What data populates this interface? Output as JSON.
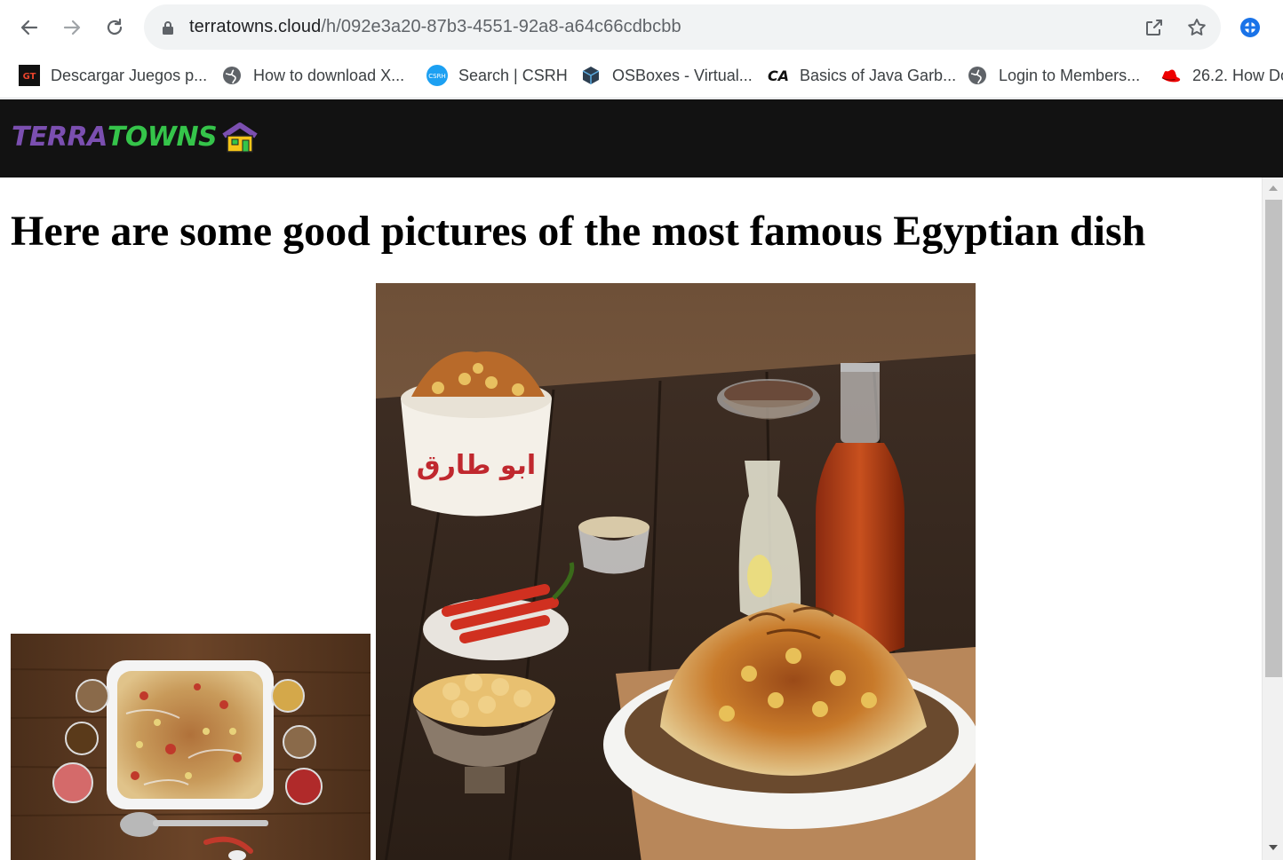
{
  "browser": {
    "url_host": "terratowns.cloud",
    "url_path": "/h/092e3a20-87b3-4551-92a8-a64c66cdbcbb",
    "bookmarks": [
      {
        "label": "Descargar Juegos p...",
        "icon": "gt-icon"
      },
      {
        "label": "How to download X...",
        "icon": "globe-icon"
      },
      {
        "label": "Search | CSRH",
        "icon": "csrh-icon"
      },
      {
        "label": "OSBoxes - Virtual...",
        "icon": "cube-icon"
      },
      {
        "label": "Basics of Java Garb...",
        "icon": "ca-icon"
      },
      {
        "label": "Login to Members...",
        "icon": "globe-icon"
      },
      {
        "label": "26.2. How Do",
        "icon": "redhat-icon"
      }
    ]
  },
  "site": {
    "logo_terra": "TERRA",
    "logo_towns": "TOWNS"
  },
  "page": {
    "title": "Here are some good pictures of the most famous Egyptian dish",
    "images": [
      {
        "description": "koshari platter"
      },
      {
        "description": "koshari bowl",
        "bowl_text": "ابو طارق"
      }
    ]
  },
  "colors": {
    "header_bg": "#121212",
    "logo_purple": "#7b4fb0",
    "logo_green": "#35c44a"
  }
}
